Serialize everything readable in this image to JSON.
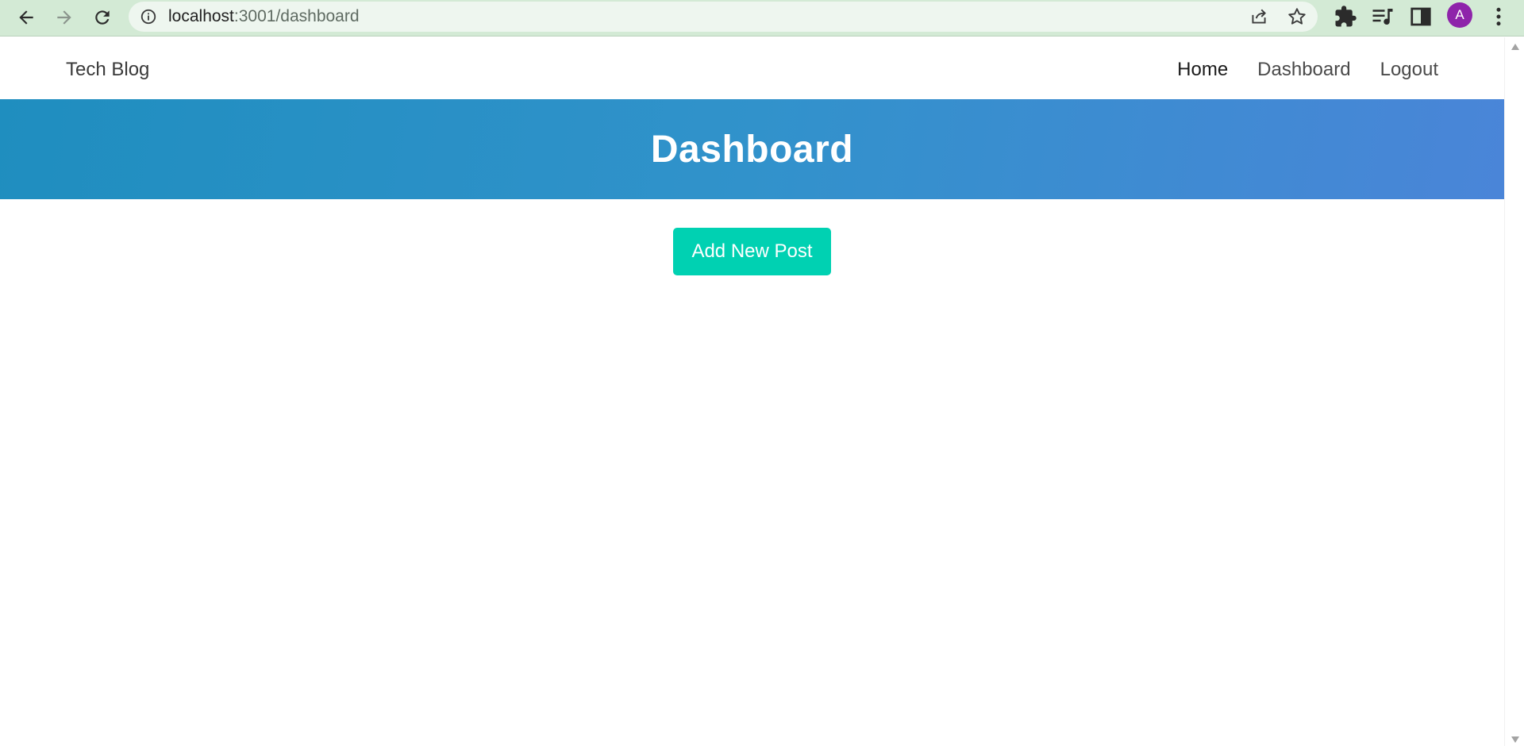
{
  "browser": {
    "url_host": "localhost",
    "url_path": ":3001/dashboard",
    "profile_initial": "A",
    "icons": [
      "back-arrow-icon",
      "forward-arrow-icon",
      "reload-icon",
      "info-icon",
      "share-icon",
      "star-icon",
      "puzzle-icon",
      "media-queue-icon",
      "side-panel-icon",
      "kebab-menu-icon"
    ],
    "colors": {
      "toolbar": "#d3ead5",
      "omnibox": "#eef6ef",
      "avatar": "#8e24aa"
    }
  },
  "site_nav": {
    "brand": "Tech Blog",
    "links": [
      {
        "label": "Home"
      },
      {
        "label": "Dashboard"
      },
      {
        "label": "Logout"
      }
    ]
  },
  "hero": {
    "title": "Dashboard",
    "colors": {
      "gradient_start": "#1f8ebf",
      "gradient_end": "#4a85d8"
    }
  },
  "main": {
    "add_post_label": "Add New Post",
    "colors": {
      "button": "#00d1b2"
    }
  }
}
